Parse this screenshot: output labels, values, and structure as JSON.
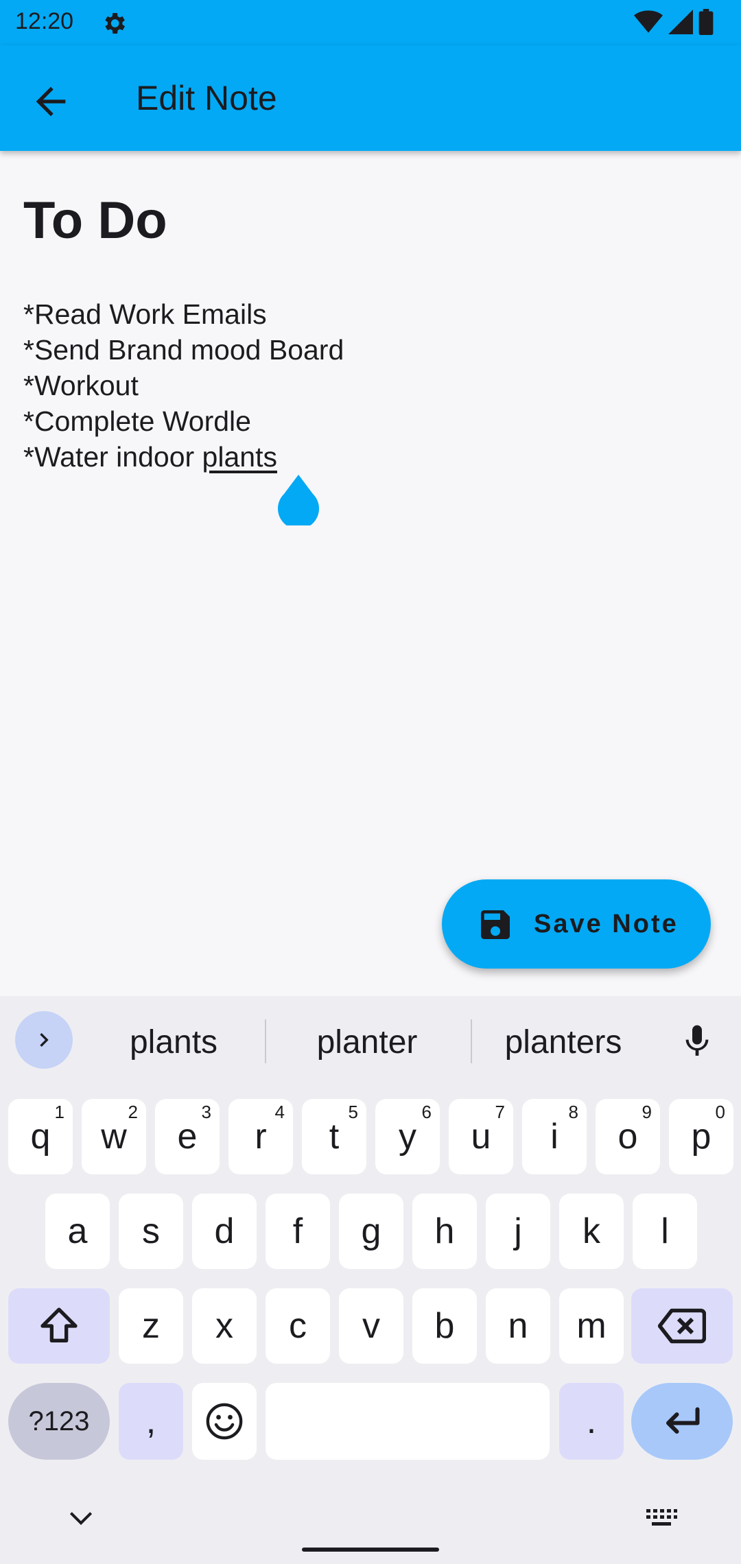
{
  "status_bar": {
    "time": "12:20"
  },
  "app_bar": {
    "title": "Edit Note"
  },
  "note": {
    "title": "To Do",
    "lines": [
      "*Read Work Emails",
      "*Send Brand mood Board",
      "*Workout",
      "*Complete Wordle"
    ],
    "last_line_prefix": "*Water indoor ",
    "last_line_word": "plants"
  },
  "fab": {
    "label": "Save Note"
  },
  "keyboard": {
    "suggestions": [
      "plants",
      "planter",
      "planters"
    ],
    "row1": [
      {
        "k": "q",
        "h": "1"
      },
      {
        "k": "w",
        "h": "2"
      },
      {
        "k": "e",
        "h": "3"
      },
      {
        "k": "r",
        "h": "4"
      },
      {
        "k": "t",
        "h": "5"
      },
      {
        "k": "y",
        "h": "6"
      },
      {
        "k": "u",
        "h": "7"
      },
      {
        "k": "i",
        "h": "8"
      },
      {
        "k": "o",
        "h": "9"
      },
      {
        "k": "p",
        "h": "0"
      }
    ],
    "row2": [
      "a",
      "s",
      "d",
      "f",
      "g",
      "h",
      "j",
      "k",
      "l"
    ],
    "row3": [
      "z",
      "x",
      "c",
      "v",
      "b",
      "n",
      "m"
    ],
    "symbols_key": "?123",
    "comma_key": ",",
    "period_key": "."
  },
  "colors": {
    "accent": "#03a9f4",
    "background": "#f7f6f8",
    "keyboard_bg": "#eeeef2",
    "mod_key": "#dcdcfa",
    "enter_key": "#a8c8fa"
  }
}
